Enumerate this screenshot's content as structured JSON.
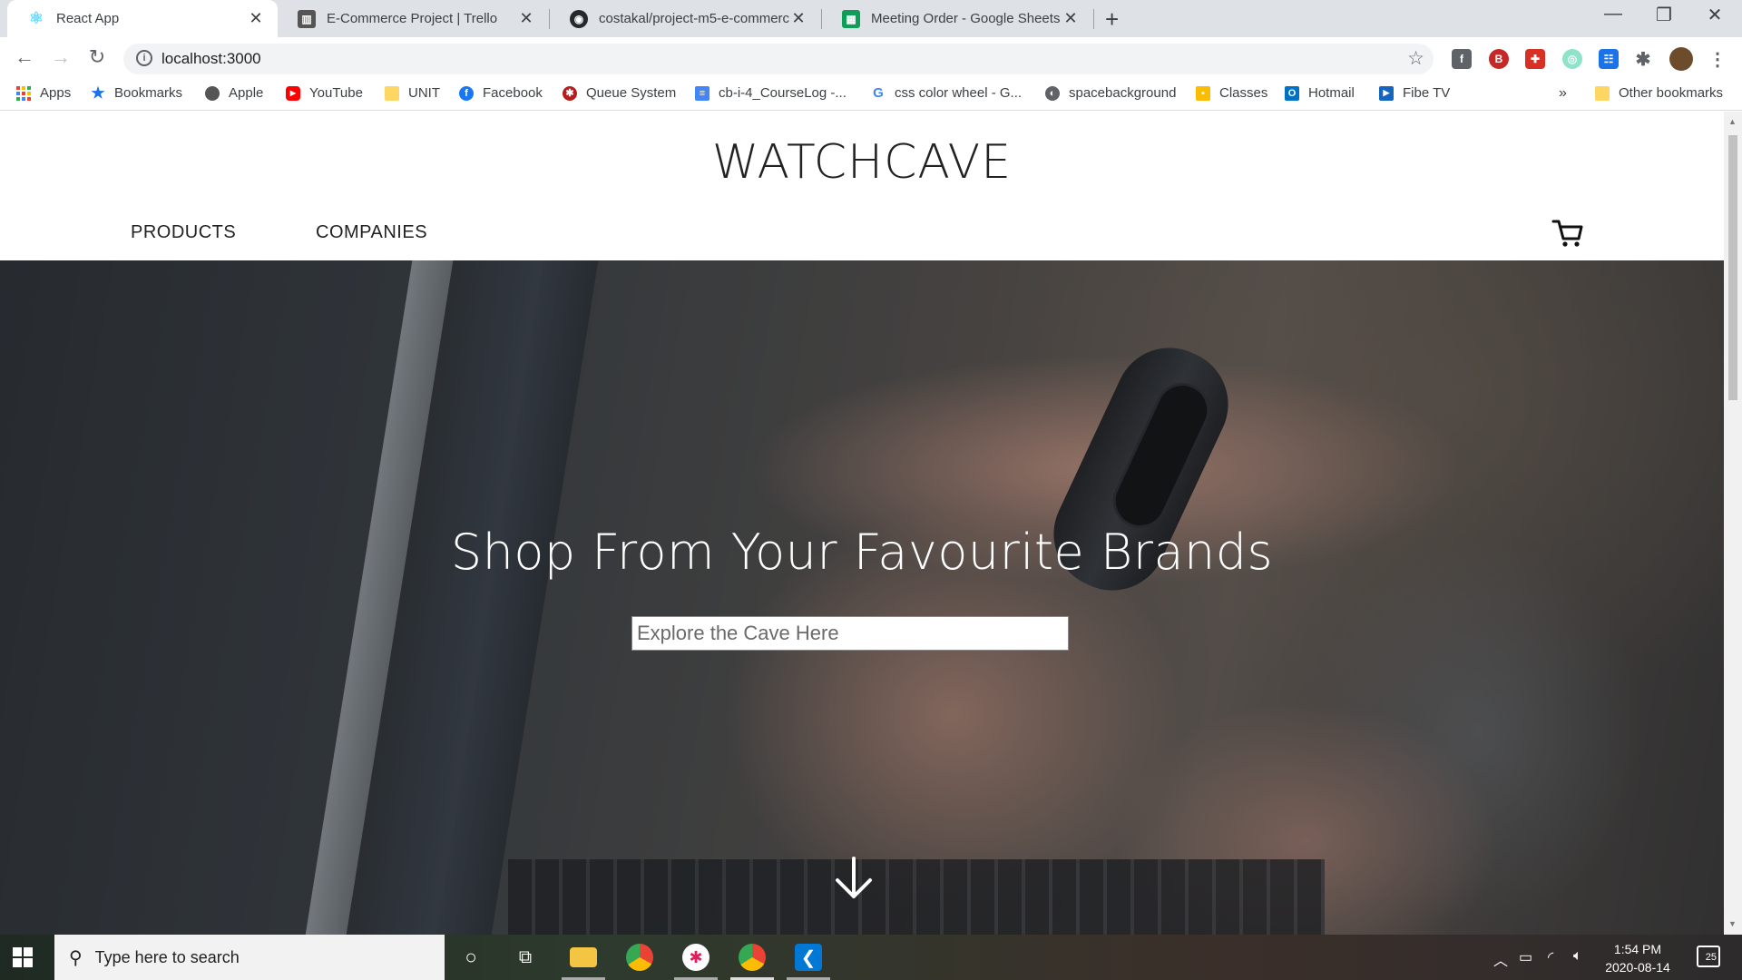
{
  "browser": {
    "tabs": [
      {
        "title": "React App",
        "icon": "react-icon",
        "color": "#61dafb"
      },
      {
        "title": "E-Commerce Project | Trello",
        "icon": "trello-icon",
        "color": "#555555"
      },
      {
        "title": "costakal/project-m5-e-commerce",
        "icon": "github-icon",
        "color": "#24292e"
      },
      {
        "title": "Meeting Order - Google Sheets",
        "icon": "sheets-icon",
        "color": "#0f9d58"
      }
    ],
    "url": "localhost:3000"
  },
  "bookmarks": [
    {
      "label": "Apps",
      "icon": "apps-icon"
    },
    {
      "label": "Bookmarks",
      "icon": "star-icon"
    },
    {
      "label": "Apple",
      "icon": "apple-icon"
    },
    {
      "label": "YouTube",
      "icon": "youtube-icon"
    },
    {
      "label": "UNIT",
      "icon": "folder-icon"
    },
    {
      "label": "Facebook",
      "icon": "facebook-icon"
    },
    {
      "label": "Queue System",
      "icon": "queue-icon"
    },
    {
      "label": "cb-i-4_CourseLog -...",
      "icon": "docs-icon"
    },
    {
      "label": "css color wheel - G...",
      "icon": "google-icon"
    },
    {
      "label": "spacebackground",
      "icon": "globe-icon"
    },
    {
      "label": "Classes",
      "icon": "classroom-icon"
    },
    {
      "label": "Hotmail",
      "icon": "outlook-icon"
    },
    {
      "label": "Fibe TV",
      "icon": "fibe-icon"
    }
  ],
  "bookmarks_more": "»",
  "bookmarks_other": "Other bookmarks",
  "site": {
    "brand": "WATCHCAVE",
    "nav": [
      {
        "label": "PRODUCTS"
      },
      {
        "label": "COMPANIES"
      }
    ],
    "hero_title": "Shop From Your Favourite Brands",
    "search_placeholder": "Explore the Cave Here"
  },
  "taskbar": {
    "search_placeholder": "Type here to search",
    "time": "1:54 PM",
    "date": "2020-08-14",
    "notifications": "25"
  }
}
